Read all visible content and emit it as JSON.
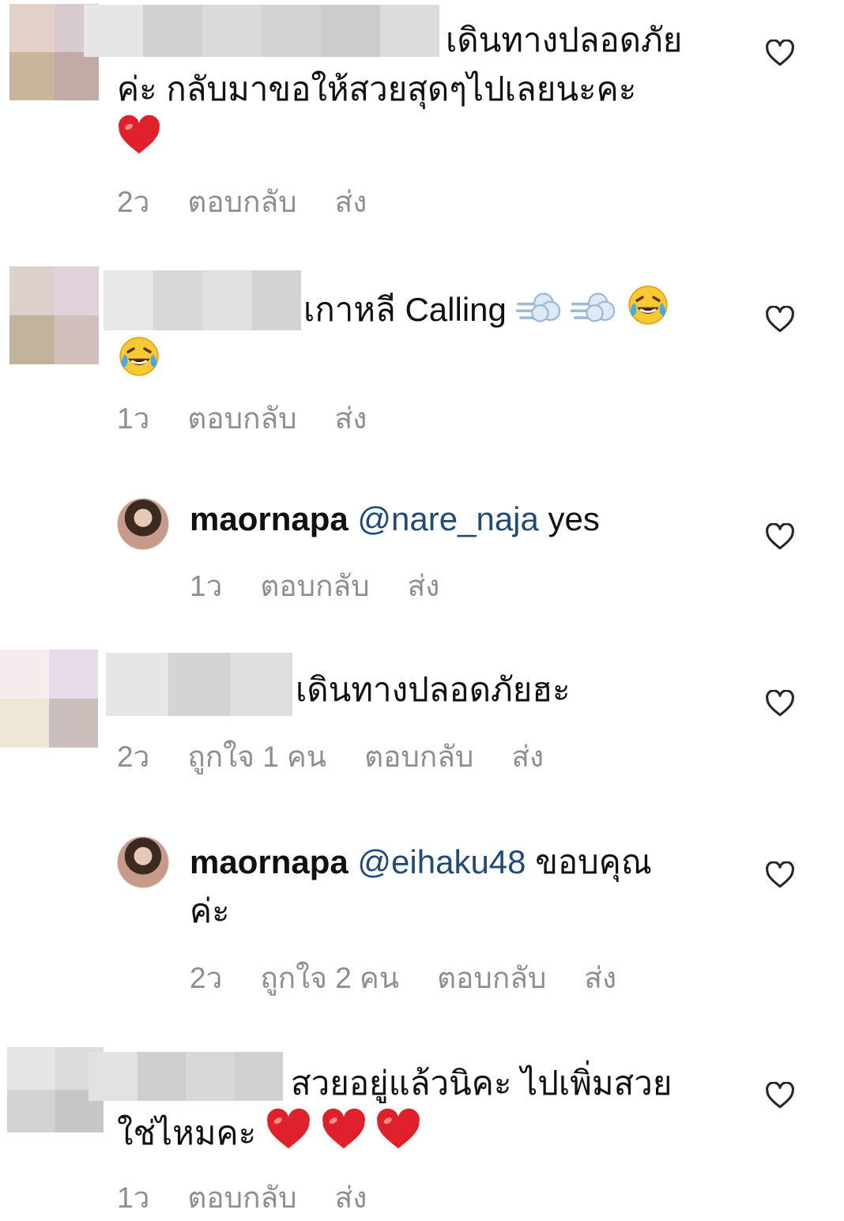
{
  "comments": [
    {
      "line1": "เดินทางปลอดภัย",
      "line2": "ค่ะ กลับมาขอให้สวยสุดๆไปเลยนะคะ",
      "emoji": [
        "red-heart"
      ],
      "time": "2ว",
      "reply_label": "ตอบกลับ",
      "send_label": "ส่ง"
    },
    {
      "text": "เกาหลี Calling",
      "emoji": [
        "dash",
        "dash",
        "tears-of-joy",
        "tears-of-joy"
      ],
      "time": "1ว",
      "reply_label": "ตอบกลับ",
      "send_label": "ส่ง"
    },
    {
      "username": "maornapa",
      "mention": "@nare_naja",
      "text": "yes",
      "time": "1ว",
      "reply_label": "ตอบกลับ",
      "send_label": "ส่ง"
    },
    {
      "text": "เดินทางปลอดภัยฮะ",
      "time": "2ว",
      "likes": "ถูกใจ 1 คน",
      "reply_label": "ตอบกลับ",
      "send_label": "ส่ง"
    },
    {
      "username": "maornapa",
      "mention": "@eihaku48",
      "text_line1": "ขอบคุณ",
      "text_line2": "ค่ะ",
      "time": "2ว",
      "likes": "ถูกใจ 2 คน",
      "reply_label": "ตอบกลับ",
      "send_label": "ส่ง"
    },
    {
      "line1": "สวยอยู่แล้วนิคะ ไปเพิ่มสวย",
      "line2": "ใช่ไหมคะ",
      "emoji": [
        "red-heart",
        "red-heart",
        "red-heart"
      ],
      "time": "1ว",
      "reply_label": "ตอบกลับ",
      "send_label": "ส่ง"
    }
  ],
  "icons": {
    "like": "heart-outline-icon",
    "avatar": "profile-photo"
  },
  "colors": {
    "text": "#111111",
    "meta": "#8e8e8e",
    "mention": "#1f4a7a",
    "heart_icon": "#262626",
    "emoji_heart": "#e0202a"
  }
}
